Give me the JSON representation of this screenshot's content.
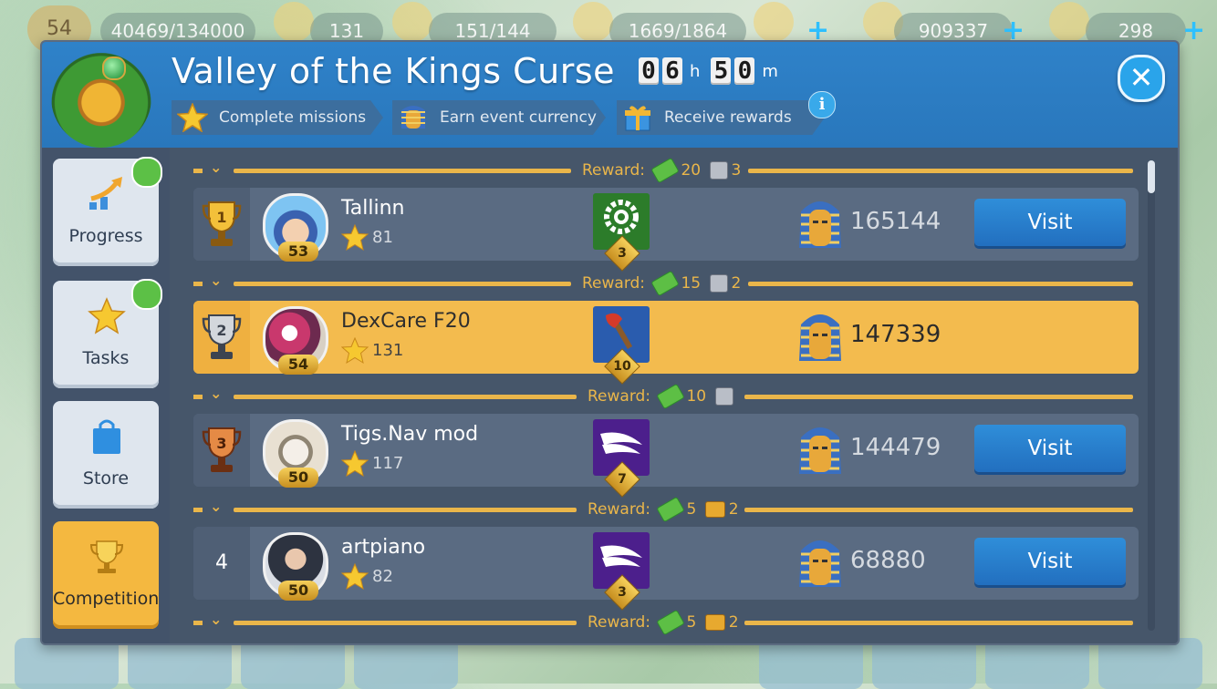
{
  "hud": {
    "level": "54",
    "xp": "40469/134000",
    "stars": "131",
    "population": "151/144",
    "storage": "1669/1864",
    "coins": "909337",
    "cash": "298"
  },
  "event": {
    "title": "Valley of the Kings Curse",
    "timer": {
      "hours": [
        "0",
        "6"
      ],
      "hours_unit": "h",
      "minutes": [
        "5",
        "0"
      ],
      "minutes_unit": "m"
    },
    "steps": [
      "Complete missions",
      "Earn event currency",
      "Receive rewards"
    ],
    "info_label": "i",
    "close_label": "✕"
  },
  "sidebar": {
    "items": [
      {
        "label": "Progress",
        "icon": "progress-arrow-icon",
        "gift": true
      },
      {
        "label": "Tasks",
        "icon": "star-icon",
        "gift": true
      },
      {
        "label": "Store",
        "icon": "shopping-bag-icon",
        "gift": false
      },
      {
        "label": "Competition",
        "icon": "trophy-icon",
        "gift": false,
        "active": true
      }
    ]
  },
  "rewards": [
    {
      "label": "Reward:",
      "cash": "20",
      "second": "3",
      "second_icon": "relic-icon"
    },
    {
      "label": "Reward:",
      "cash": "15",
      "second": "2",
      "second_icon": "relic-icon"
    },
    {
      "label": "Reward:",
      "cash": "10",
      "second": "",
      "second_icon": "relic-icon"
    },
    {
      "label": "Reward:",
      "cash": "5",
      "second": "2",
      "second_icon": "chest-icon"
    },
    {
      "label": "Reward:",
      "cash": "5",
      "second": "2",
      "second_icon": "chest-icon"
    }
  ],
  "players": [
    {
      "rank": "1",
      "name": "Tallinn",
      "level": "53",
      "stars": "81",
      "club_level": "3",
      "score": "165144",
      "visit": "Visit",
      "me": false
    },
    {
      "rank": "2",
      "name": "DexCare F20",
      "level": "54",
      "stars": "131",
      "club_level": "10",
      "score": "147339",
      "visit": "",
      "me": true
    },
    {
      "rank": "3",
      "name": "Tigs.Nav mod",
      "level": "50",
      "stars": "117",
      "club_level": "7",
      "score": "144479",
      "visit": "Visit",
      "me": false
    },
    {
      "rank": "4",
      "name": "artpiano",
      "level": "50",
      "stars": "82",
      "club_level": "3",
      "score": "68880",
      "visit": "Visit",
      "me": false
    }
  ],
  "colors": {
    "header_blue": "#2f82c9",
    "panel": "#46566a",
    "row": "#5a6b82",
    "highlight": "#f3bb4e",
    "gold": "#eab64a",
    "visit_blue": "#2f8ed9"
  }
}
